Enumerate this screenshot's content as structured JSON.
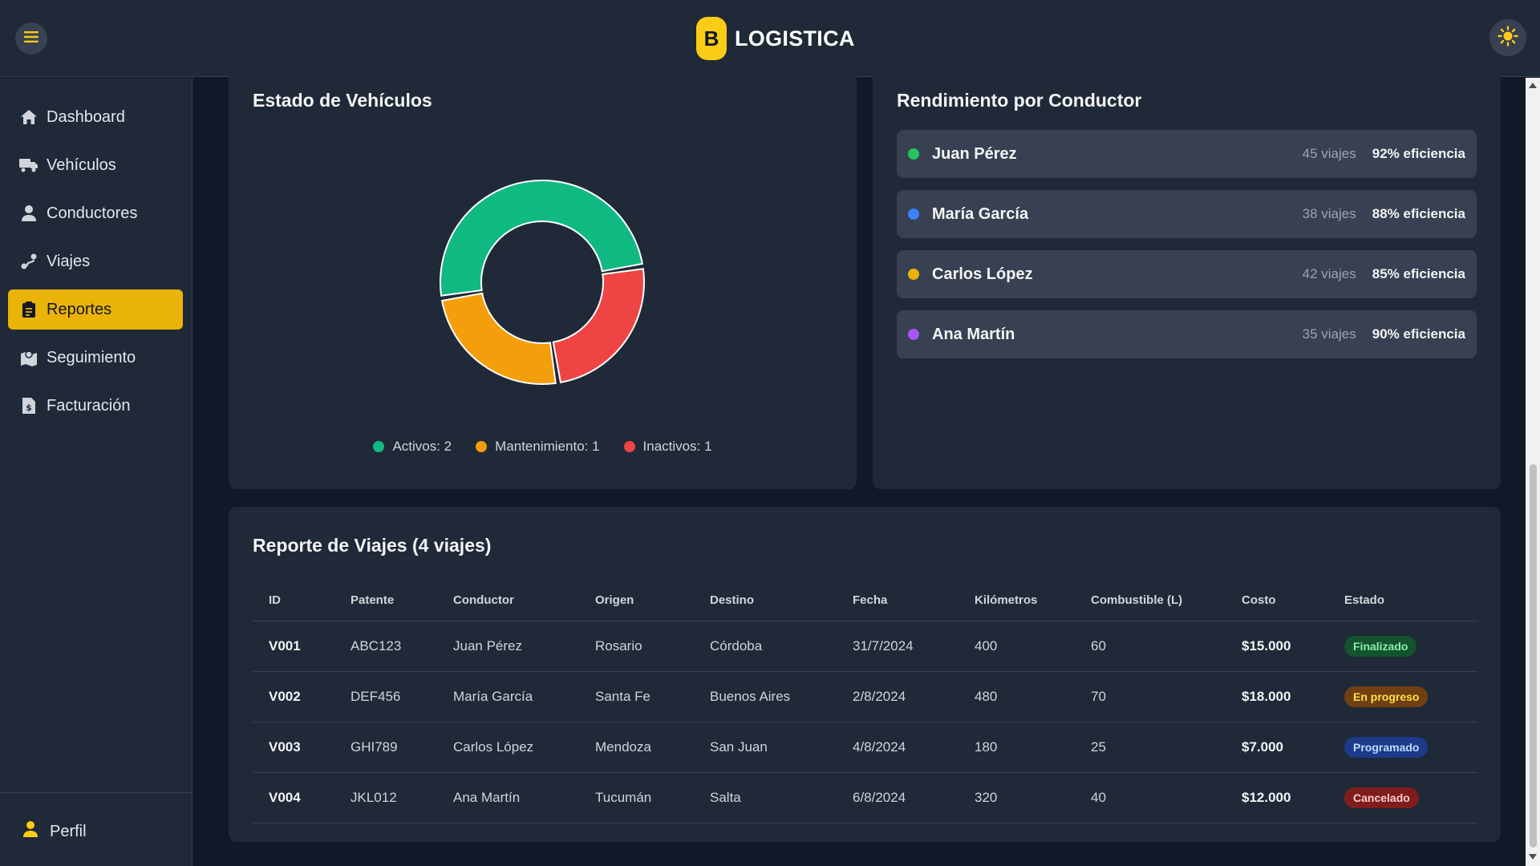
{
  "header": {
    "brand_letter": "B",
    "brand_name": "LOGISTICA"
  },
  "sidebar": {
    "items": [
      {
        "label": "Dashboard",
        "icon": "home-icon"
      },
      {
        "label": "Vehículos",
        "icon": "truck-icon"
      },
      {
        "label": "Conductores",
        "icon": "user-icon"
      },
      {
        "label": "Viajes",
        "icon": "route-icon"
      },
      {
        "label": "Reportes",
        "icon": "clipboard-icon",
        "active": true
      },
      {
        "label": "Seguimiento",
        "icon": "map-icon"
      },
      {
        "label": "Facturación",
        "icon": "invoice-icon"
      }
    ],
    "profile_label": "Perfil"
  },
  "vehicles_card": {
    "title": "Estado de Vehículos",
    "legend": {
      "active": "Activos: 2",
      "maintenance": "Mantenimiento: 1",
      "inactive": "Inactivos: 1"
    }
  },
  "chart_data": {
    "type": "pie",
    "variant": "donut",
    "title": "Estado de Vehículos",
    "categories": [
      "Activos",
      "Mantenimiento",
      "Inactivos"
    ],
    "values": [
      2,
      1,
      1
    ],
    "colors": [
      "#10b981",
      "#f59e0b",
      "#ef4444"
    ],
    "legend_position": "bottom"
  },
  "drivers_card": {
    "title": "Rendimiento por Conductor",
    "drivers": [
      {
        "name": "Juan Pérez",
        "trips": "45 viajes",
        "efficiency": "92% eficiencia",
        "color": "#22c55e"
      },
      {
        "name": "María García",
        "trips": "38 viajes",
        "efficiency": "88% eficiencia",
        "color": "#3b82f6"
      },
      {
        "name": "Carlos López",
        "trips": "42 viajes",
        "efficiency": "85% eficiencia",
        "color": "#eab308"
      },
      {
        "name": "Ana Martín",
        "trips": "35 viajes",
        "efficiency": "90% eficiencia",
        "color": "#a855f7"
      }
    ]
  },
  "trips_report": {
    "title": "Reporte de Viajes (4 viajes)",
    "columns": [
      "ID",
      "Patente",
      "Conductor",
      "Origen",
      "Destino",
      "Fecha",
      "Kilómetros",
      "Combustible (L)",
      "Costo",
      "Estado"
    ],
    "rows": [
      {
        "id": "V001",
        "plate": "ABC123",
        "driver": "Juan Pérez",
        "origin": "Rosario",
        "destination": "Córdoba",
        "date": "31/7/2024",
        "km": "400",
        "fuel": "60",
        "cost": "$15.000",
        "status": "Finalizado",
        "status_bg": "#14532d",
        "status_fg": "#86efac"
      },
      {
        "id": "V002",
        "plate": "DEF456",
        "driver": "María García",
        "origin": "Santa Fe",
        "destination": "Buenos Aires",
        "date": "2/8/2024",
        "km": "480",
        "fuel": "70",
        "cost": "$18.000",
        "status": "En progreso",
        "status_bg": "#713f12",
        "status_fg": "#fde047"
      },
      {
        "id": "V003",
        "plate": "GHI789",
        "driver": "Carlos López",
        "origin": "Mendoza",
        "destination": "San Juan",
        "date": "4/8/2024",
        "km": "180",
        "fuel": "25",
        "cost": "$7.000",
        "status": "Programado",
        "status_bg": "#1e3a8a",
        "status_fg": "#bfdbfe"
      },
      {
        "id": "V004",
        "plate": "JKL012",
        "driver": "Ana Martín",
        "origin": "Tucumán",
        "destination": "Salta",
        "date": "6/8/2024",
        "km": "320",
        "fuel": "40",
        "cost": "$12.000",
        "status": "Cancelado",
        "status_bg": "#7f1d1d",
        "status_fg": "#fecaca"
      }
    ]
  }
}
